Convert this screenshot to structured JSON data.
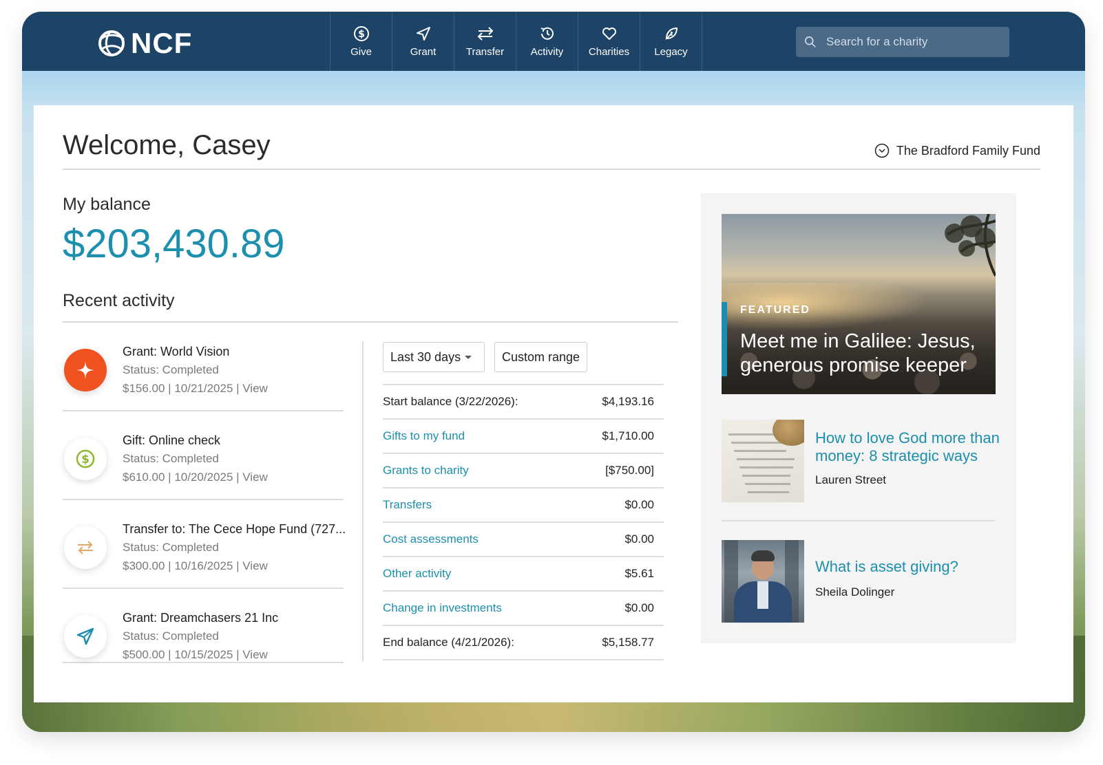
{
  "brand": {
    "logo_text": "NCF"
  },
  "nav": {
    "items": [
      {
        "label": "Give",
        "icon": "dollar-circle-icon"
      },
      {
        "label": "Grant",
        "icon": "paper-plane-icon"
      },
      {
        "label": "Transfer",
        "icon": "arrows-exchange-icon"
      },
      {
        "label": "Activity",
        "icon": "history-icon"
      },
      {
        "label": "Charities",
        "icon": "heart-icon"
      },
      {
        "label": "Legacy",
        "icon": "leaf-icon"
      }
    ],
    "search_placeholder": "Search for a charity"
  },
  "header": {
    "welcome": "Welcome, Casey",
    "fund_name": "The Bradford Family Fund"
  },
  "balance": {
    "label": "My balance",
    "value": "$203,430.89"
  },
  "recent_activity": {
    "title": "Recent activity",
    "items": [
      {
        "title": "Grant: World Vision",
        "status": "Status: Completed",
        "meta": "$156.00 | 10/21/2025 | View",
        "icon": "world-vision-logo-icon"
      },
      {
        "title": "Gift: Online check",
        "status": "Status: Completed",
        "meta": "$610.00 | 10/20/2025 | View",
        "icon": "dollar-circle-icon"
      },
      {
        "title": "Transfer to: The Cece Hope Fund (727...",
        "status": "Status: Completed",
        "meta": "$300.00 | 10/16/2025 | View",
        "icon": "arrows-exchange-icon"
      },
      {
        "title": "Grant: Dreamchasers 21 Inc",
        "status": "Status: Completed",
        "meta": "$500.00 | 10/15/2025 | View",
        "icon": "paper-plane-icon"
      }
    ]
  },
  "summary": {
    "range_selected": "Last 30 days",
    "custom_range_label": "Custom range",
    "rows": [
      {
        "label": "Start balance (3/22/2026):",
        "amount": "$4,193.16",
        "link": false
      },
      {
        "label": "Gifts to my fund",
        "amount": "$1,710.00",
        "link": true
      },
      {
        "label": "Grants to charity",
        "amount": "[$750.00]",
        "link": true
      },
      {
        "label": "Transfers",
        "amount": "$0.00",
        "link": true
      },
      {
        "label": "Cost assessments",
        "amount": "$0.00",
        "link": true
      },
      {
        "label": "Other activity",
        "amount": "$5.61",
        "link": true
      },
      {
        "label": "Change in investments",
        "amount": "$0.00",
        "link": true
      },
      {
        "label": "End balance (4/21/2026):",
        "amount": "$5,158.77",
        "link": false
      }
    ]
  },
  "featured": {
    "tag": "FEATURED",
    "title": "Meet me in Galilee: Jesus, generous promise keeper"
  },
  "articles": [
    {
      "title": "How to love God more than money: 8 strategic ways",
      "author": "Lauren Street"
    },
    {
      "title": "What is asset giving?",
      "author": "Sheila Dolinger"
    }
  ],
  "colors": {
    "nav_bg": "#1d4466",
    "accent": "#1c8fae",
    "world_vision_orange": "#f0521f",
    "gift_green": "#8cb82b",
    "transfer_tan": "#e0a86a"
  }
}
